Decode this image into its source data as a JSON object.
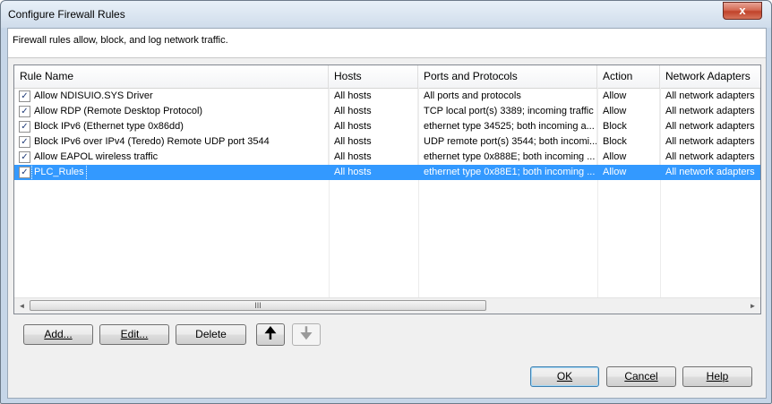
{
  "window": {
    "title": "Configure Firewall Rules",
    "close_label": "x"
  },
  "description": "Firewall rules allow, block, and log network traffic.",
  "table": {
    "columns": [
      "Rule Name",
      "Hosts",
      "Ports and Protocols",
      "Action",
      "Network Adapters"
    ],
    "rows": [
      {
        "checked": true,
        "name": "Allow NDISUIO.SYS Driver",
        "hosts": "All hosts",
        "ports": "All ports and protocols",
        "action": "Allow",
        "adapters": "All network adapters",
        "selected": false
      },
      {
        "checked": true,
        "name": "Allow RDP (Remote Desktop Protocol)",
        "hosts": "All hosts",
        "ports": "TCP local port(s) 3389; incoming traffic",
        "action": "Allow",
        "adapters": "All network adapters",
        "selected": false
      },
      {
        "checked": true,
        "name": "Block IPv6 (Ethernet type 0x86dd)",
        "hosts": "All hosts",
        "ports": "ethernet type 34525; both incoming a...",
        "action": "Block",
        "adapters": "All network adapters",
        "selected": false
      },
      {
        "checked": true,
        "name": "Block IPv6 over IPv4 (Teredo) Remote UDP port 3544",
        "hosts": "All hosts",
        "ports": "UDP remote port(s) 3544; both incomi...",
        "action": "Block",
        "adapters": "All network adapters",
        "selected": false
      },
      {
        "checked": true,
        "name": "Allow EAPOL wireless traffic",
        "hosts": "All hosts",
        "ports": "ethernet type 0x888E; both incoming ...",
        "action": "Allow",
        "adapters": "All network adapters",
        "selected": false
      },
      {
        "checked": true,
        "name": "PLC_Rules",
        "hosts": "All hosts",
        "ports": "ethernet type 0x88E1; both incoming ...",
        "action": "Allow",
        "adapters": "All network adapters",
        "selected": true
      }
    ]
  },
  "scrollbar": {
    "left_arrow": "◄",
    "right_arrow": "►",
    "grip": "III"
  },
  "buttons": {
    "add": "Add...",
    "edit": "Edit...",
    "delete": "Delete",
    "move_up": "🠉",
    "move_down": "🠋",
    "ok": "OK",
    "cancel": "Cancel",
    "help": "Help"
  }
}
